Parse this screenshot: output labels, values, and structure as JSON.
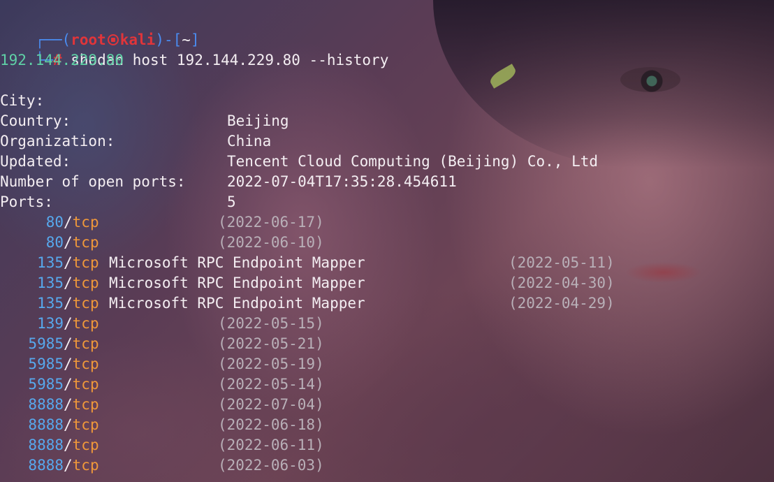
{
  "prompt": {
    "open_paren": "(",
    "user": "root",
    "host": "kali",
    "close_paren": ")",
    "dash": "-",
    "dir_open": "[",
    "dir": "~",
    "dir_close": "]",
    "symbol": "#",
    "command": "shodan host 192.144.229.80 --history"
  },
  "result": {
    "ip": "192.144.229.80",
    "fields": [
      {
        "label": "City:",
        "value": "Beijing"
      },
      {
        "label": "Country:",
        "value": "China"
      },
      {
        "label": "Organization:",
        "value": "Tencent Cloud Computing (Beijing) Co., Ltd"
      },
      {
        "label": "Updated:",
        "value": "2022-07-04T17:35:28.454611"
      },
      {
        "label": "Number of open ports:",
        "value": "5"
      }
    ],
    "ports_header": "Ports:",
    "ports": [
      {
        "port": "80",
        "proto": "tcp",
        "service": "",
        "date": "(2022-06-17)"
      },
      {
        "port": "80",
        "proto": "tcp",
        "service": "",
        "date": "(2022-06-10)"
      },
      {
        "port": "135",
        "proto": "tcp",
        "service": "Microsoft RPC Endpoint Mapper",
        "date": "(2022-05-11)"
      },
      {
        "port": "135",
        "proto": "tcp",
        "service": "Microsoft RPC Endpoint Mapper",
        "date": "(2022-04-30)"
      },
      {
        "port": "135",
        "proto": "tcp",
        "service": "Microsoft RPC Endpoint Mapper",
        "date": "(2022-04-29)"
      },
      {
        "port": "139",
        "proto": "tcp",
        "service": "",
        "date": "(2022-05-15)"
      },
      {
        "port": "5985",
        "proto": "tcp",
        "service": "",
        "date": "(2022-05-21)"
      },
      {
        "port": "5985",
        "proto": "tcp",
        "service": "",
        "date": "(2022-05-19)"
      },
      {
        "port": "5985",
        "proto": "tcp",
        "service": "",
        "date": "(2022-05-14)"
      },
      {
        "port": "8888",
        "proto": "tcp",
        "service": "",
        "date": "(2022-07-04)"
      },
      {
        "port": "8888",
        "proto": "tcp",
        "service": "",
        "date": "(2022-06-18)"
      },
      {
        "port": "8888",
        "proto": "tcp",
        "service": "",
        "date": "(2022-06-11)"
      },
      {
        "port": "8888",
        "proto": "tcp",
        "service": "",
        "date": "(2022-06-03)"
      }
    ]
  },
  "colors": {
    "prompt_frame": "#4a8cf0",
    "user_host": "#e0353a",
    "ip": "#5fd1a6",
    "port": "#57a9ee",
    "proto": "#f0983a",
    "date": "#b9b0b8",
    "text": "#f4eef2"
  },
  "icons": {
    "prompt_separator": "skull-icon"
  }
}
